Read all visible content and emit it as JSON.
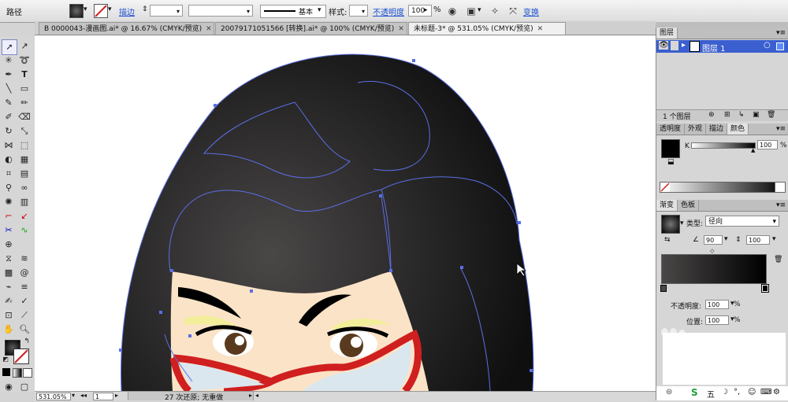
{
  "control_bar": {
    "mode_label": "路径",
    "stroke_link": "描边",
    "stroke_profile": "基本",
    "style_label": "样式:",
    "opacity_link": "不透明度",
    "opacity_value": "100",
    "opacity_unit": "%",
    "transform_link": "变换"
  },
  "tabs": [
    {
      "label": "B 0000043-漫画图.ai* @ 16.67% (CMYK/预览)",
      "active": false
    },
    {
      "label": "20079171051566 [转换].ai* @ 100% (CMYK/预览)",
      "active": false
    },
    {
      "label": "未标题-3* @ 531.05% (CMYK/预览)",
      "active": true
    }
  ],
  "tab_close": "✕",
  "status_bar": {
    "zoom": "531.05%",
    "page": "1",
    "undo_text": "27 次还原; 无重做"
  },
  "layers_panel": {
    "title": "图层",
    "layer_name": "图层 1",
    "footer": "1 个图层"
  },
  "color_panel": {
    "tabs": [
      "透明度",
      "外观",
      "描边",
      "颜色"
    ],
    "active_tab": "颜色",
    "channel": "K",
    "k_value": "100",
    "k_unit": "%"
  },
  "gradient_panel": {
    "tabs": [
      "渐变",
      "色板"
    ],
    "active_tab": "渐变",
    "type_label": "类型:",
    "type_value": "径向",
    "angle_value": "90",
    "aspect_value": "100",
    "opacity_label": "不透明度:",
    "opacity_value": "100",
    "position_label": "位置:",
    "position_value": "100",
    "unit": "%"
  },
  "colors": {
    "hair_dark": "#0f0f0f",
    "hair_highlight": "#4a4747",
    "skin": "#fbe3c7",
    "glasses_red": "#d01f1f",
    "path_blue": "#5a6fe6",
    "eyeshadow": "#f2ee9a",
    "iris": "#5a3a1e",
    "link_blue": "#1d4fcf"
  }
}
